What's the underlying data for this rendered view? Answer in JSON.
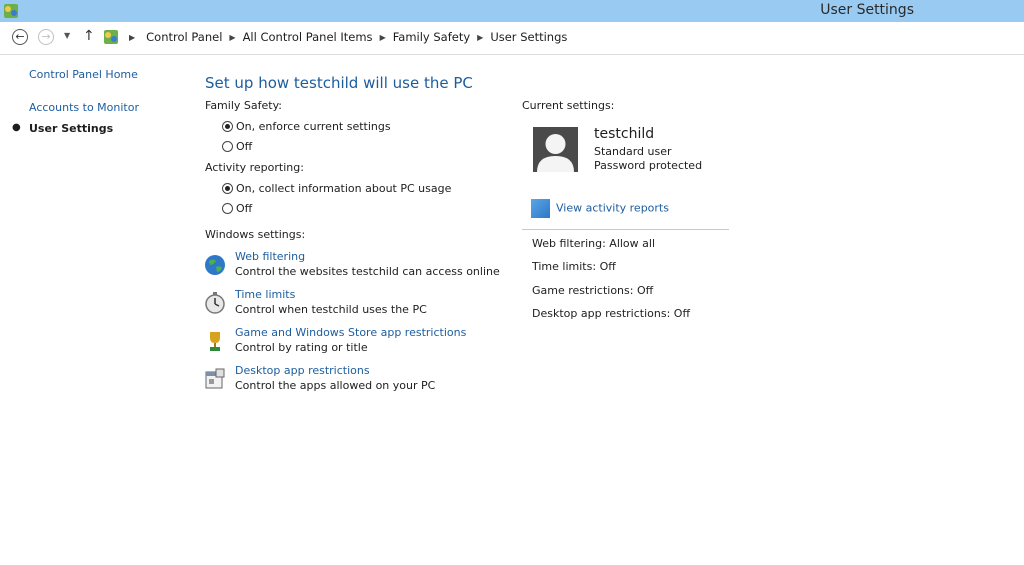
{
  "window": {
    "title": "User Settings"
  },
  "breadcrumb": [
    "Control Panel",
    "All Control Panel Items",
    "Family Safety",
    "User Settings"
  ],
  "sidebar": {
    "items": [
      {
        "label": "Control Panel Home"
      },
      {
        "label": "Accounts to Monitor"
      },
      {
        "label": "User Settings",
        "current": true
      }
    ]
  },
  "main": {
    "heading": "Set up how testchild will use the PC",
    "family_safety": {
      "label": "Family Safety:",
      "options": [
        "On, enforce current settings",
        "Off"
      ],
      "selected": "On, enforce current settings"
    },
    "activity_reporting": {
      "label": "Activity reporting:",
      "options": [
        "On, collect information about PC usage",
        "Off"
      ],
      "selected": "On, collect information about PC usage"
    },
    "windows_settings": {
      "label": "Windows settings:",
      "items": [
        {
          "icon": "globe-icon",
          "title": "Web filtering",
          "desc": "Control the websites testchild can access online"
        },
        {
          "icon": "stopwatch-icon",
          "title": "Time limits",
          "desc": "Control when testchild uses the PC"
        },
        {
          "icon": "trophy-icon",
          "title": "Game and Windows Store app restrictions",
          "desc": "Control by rating or title"
        },
        {
          "icon": "app-window-icon",
          "title": "Desktop app restrictions",
          "desc": "Control the apps allowed on your PC"
        }
      ]
    }
  },
  "current": {
    "label": "Current settings:",
    "user": {
      "name": "testchild",
      "type": "Standard user",
      "status": "Password protected"
    },
    "report_link": "View activity reports",
    "summary": [
      {
        "label": "Web filtering:",
        "value": "Allow all"
      },
      {
        "label": "Time limits:",
        "value": "Off"
      },
      {
        "label": "Game restrictions:",
        "value": "Off"
      },
      {
        "label": "Desktop app restrictions:",
        "value": "Off"
      }
    ]
  },
  "colors": {
    "titlebar": "#99cbf2",
    "link": "#1c5d9e"
  }
}
